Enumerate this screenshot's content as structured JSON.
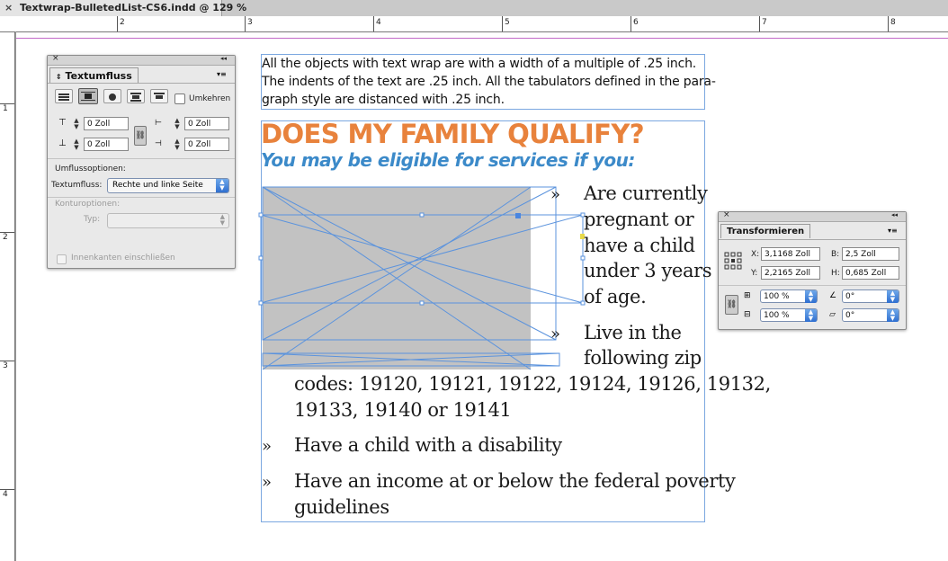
{
  "document_tab": {
    "close_glyph": "×",
    "title": "Textwrap-BulletedList-CS6.indd @ 129 %"
  },
  "ruler": {
    "horizontal_numbers": [
      "2",
      "3",
      "4",
      "5",
      "6",
      "7",
      "8"
    ],
    "vertical_numbers": [
      "1",
      "2",
      "3",
      "4"
    ]
  },
  "note_frame": {
    "lines": [
      "All the objects with text wrap are with a width of a multiple of .25 inch.",
      "The indents of the text are .25 inch. All the tabulators defined in the para-",
      "graph style are distanced with .25 inch."
    ]
  },
  "flyer": {
    "headline": "DOES MY FAMILY QUALIFY?",
    "subhead": "You may be eligible for services if you:",
    "bullet_glyph": "»",
    "item1_lines": [
      "Are currently",
      "pregnant or",
      "have a child",
      "under 3 years",
      "of age."
    ],
    "item2_lines": [
      "Live in the",
      "following zip",
      "codes: 19120, 19121, 19122, 19124, 19126, 19132,",
      "19133, 19140 or 19141"
    ],
    "item3": "Have a child with a disability",
    "item4_lines": [
      "Have an income at or below the federal poverty",
      "guidelines"
    ],
    "colors": {
      "headline": "#e8823c",
      "subhead": "#3c8ac9",
      "placeholder": "#c2c2c2",
      "frame": "#7ba7e0"
    }
  },
  "textwrap_panel": {
    "close_glyph": "×",
    "collapse_glyph": "◂◂",
    "tab_label": "Textumfluss",
    "invert_label": "Umkehren",
    "offsets": {
      "top": "0 Zoll",
      "bottom": "0 Zoll",
      "left": "0 Zoll",
      "right": "0 Zoll"
    },
    "wrap_options_heading": "Umflussoptionen:",
    "wrap_to_label": "Textumfluss:",
    "wrap_to_value": "Rechte und linke Seite",
    "contour_heading": "Konturoptionen:",
    "type_label": "Typ:",
    "type_value": "",
    "inside_edges_label": "Innenkanten einschließen"
  },
  "transform_panel": {
    "close_glyph": "×",
    "collapse_glyph": "◂◂",
    "tab_label": "Transformieren",
    "x_label": "X:",
    "x_value": "3,1168 Zoll",
    "y_label": "Y:",
    "y_value": "2,2165 Zoll",
    "w_label": "B:",
    "w_value": "2,5 Zoll",
    "h_label": "H:",
    "h_value": "0,685 Zoll",
    "scale_x": "100 %",
    "scale_y": "100 %",
    "rotation": "0°",
    "shear": "0°"
  }
}
